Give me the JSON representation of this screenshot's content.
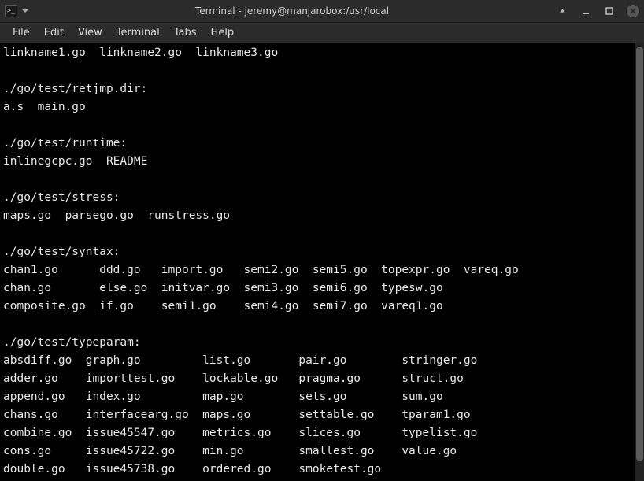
{
  "window": {
    "title": "Terminal - jeremy@manjarobox:/usr/local"
  },
  "menubar": {
    "items": [
      "File",
      "Edit",
      "View",
      "Terminal",
      "Tabs",
      "Help"
    ]
  },
  "terminal": {
    "lines": [
      "linkname1.go  linkname2.go  linkname3.go",
      "",
      "./go/test/retjmp.dir:",
      "a.s  main.go",
      "",
      "./go/test/runtime:",
      "inlinegcpc.go  README",
      "",
      "./go/test/stress:",
      "maps.go  parsego.go  runstress.go",
      "",
      "./go/test/syntax:",
      "chan1.go      ddd.go   import.go   semi2.go  semi5.go  topexpr.go  vareq.go",
      "chan.go       else.go  initvar.go  semi3.go  semi6.go  typesw.go",
      "composite.go  if.go    semi1.go    semi4.go  semi7.go  vareq1.go",
      "",
      "./go/test/typeparam:",
      "absdiff.go  graph.go         list.go       pair.go        stringer.go",
      "adder.go    importtest.go    lockable.go   pragma.go      struct.go",
      "append.go   index.go         map.go        sets.go        sum.go",
      "chans.go    interfacearg.go  maps.go       settable.go    tparam1.go",
      "combine.go  issue45547.go    metrics.go    slices.go      typelist.go",
      "cons.go     issue45722.go    min.go        smallest.go    value.go",
      "double.go   issue45738.go    ordered.go    smoketest.go"
    ]
  }
}
